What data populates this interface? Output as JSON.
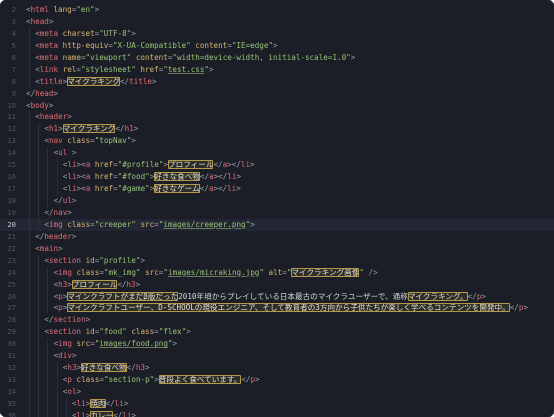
{
  "editor": {
    "theme_colors": {
      "background": "#1b1e26",
      "tag": "#e06c75",
      "attribute": "#d6b476",
      "string": "#98c379",
      "highlight_border": "#b69a4a"
    },
    "active_line": 20,
    "lines": [
      {
        "n": "2",
        "indent": 0,
        "tokens": [
          [
            "p",
            "<"
          ],
          [
            "tag",
            "html"
          ],
          [
            "t",
            " "
          ],
          [
            "attr",
            "lang"
          ],
          [
            "p",
            "="
          ],
          [
            "str",
            "\"en\""
          ],
          [
            "p",
            ">"
          ]
        ]
      },
      {
        "n": "3",
        "indent": 0,
        "tokens": [
          [
            "p",
            "<"
          ],
          [
            "tag",
            "head"
          ],
          [
            "p",
            ">"
          ]
        ]
      },
      {
        "n": "4",
        "indent": 1,
        "tokens": [
          [
            "p",
            "<"
          ],
          [
            "tag",
            "meta"
          ],
          [
            "t",
            " "
          ],
          [
            "attr",
            "charset"
          ],
          [
            "p",
            "="
          ],
          [
            "str",
            "\"UTF-8\""
          ],
          [
            "p",
            ">"
          ]
        ]
      },
      {
        "n": "5",
        "indent": 1,
        "tokens": [
          [
            "p",
            "<"
          ],
          [
            "tag",
            "meta"
          ],
          [
            "t",
            " "
          ],
          [
            "attr",
            "http-equiv"
          ],
          [
            "p",
            "="
          ],
          [
            "str",
            "\"X-UA-Compatible\""
          ],
          [
            "t",
            " "
          ],
          [
            "attr",
            "content"
          ],
          [
            "p",
            "="
          ],
          [
            "str",
            "\"IE=edge\""
          ],
          [
            "p",
            ">"
          ]
        ]
      },
      {
        "n": "6",
        "indent": 1,
        "tokens": [
          [
            "p",
            "<"
          ],
          [
            "tag",
            "meta"
          ],
          [
            "t",
            " "
          ],
          [
            "attr",
            "name"
          ],
          [
            "p",
            "="
          ],
          [
            "str",
            "\"viewport\""
          ],
          [
            "t",
            " "
          ],
          [
            "attr",
            "content"
          ],
          [
            "p",
            "="
          ],
          [
            "str",
            "\"width=device-width, initial-scale=1.0\""
          ],
          [
            "p",
            ">"
          ]
        ]
      },
      {
        "n": "7",
        "indent": 1,
        "tokens": [
          [
            "p",
            "<"
          ],
          [
            "tag",
            "link"
          ],
          [
            "t",
            " "
          ],
          [
            "attr",
            "rel"
          ],
          [
            "p",
            "="
          ],
          [
            "str",
            "\"stylesheet\""
          ],
          [
            "t",
            " "
          ],
          [
            "attr",
            "href"
          ],
          [
            "p",
            "="
          ],
          [
            "str",
            "\""
          ],
          [
            "link",
            "test.css"
          ],
          [
            "str",
            "\""
          ],
          [
            "p",
            ">"
          ]
        ]
      },
      {
        "n": "8",
        "indent": 1,
        "tokens": [
          [
            "p",
            "<"
          ],
          [
            "tag",
            "title"
          ],
          [
            "p",
            ">"
          ],
          [
            "hl",
            "マイクラキング"
          ],
          [
            "p",
            "</"
          ],
          [
            "tag",
            "title"
          ],
          [
            "p",
            ">"
          ]
        ]
      },
      {
        "n": "9",
        "indent": 0,
        "tokens": [
          [
            "p",
            "</"
          ],
          [
            "tag",
            "head"
          ],
          [
            "p",
            ">"
          ]
        ]
      },
      {
        "n": "10",
        "indent": 0,
        "tokens": [
          [
            "p",
            "<"
          ],
          [
            "tag",
            "body"
          ],
          [
            "p",
            ">"
          ]
        ]
      },
      {
        "n": "11",
        "indent": 1,
        "tokens": [
          [
            "p",
            "<"
          ],
          [
            "tag",
            "header"
          ],
          [
            "p",
            ">"
          ]
        ]
      },
      {
        "n": "12",
        "indent": 2,
        "tokens": [
          [
            "p",
            "<"
          ],
          [
            "tag",
            "h1"
          ],
          [
            "p",
            ">"
          ],
          [
            "hl",
            "マイクラキング"
          ],
          [
            "p",
            "</"
          ],
          [
            "tag",
            "h1"
          ],
          [
            "p",
            ">"
          ]
        ]
      },
      {
        "n": "13",
        "indent": 2,
        "tokens": [
          [
            "p",
            "<"
          ],
          [
            "tag",
            "nav"
          ],
          [
            "t",
            " "
          ],
          [
            "attr",
            "class"
          ],
          [
            "p",
            "="
          ],
          [
            "str",
            "\"topNav\""
          ],
          [
            "p",
            ">"
          ]
        ]
      },
      {
        "n": "14",
        "indent": 3,
        "tokens": [
          [
            "p",
            "<"
          ],
          [
            "tag",
            "ul"
          ],
          [
            "t",
            " "
          ],
          [
            "p",
            ">"
          ]
        ]
      },
      {
        "n": "15",
        "indent": 4,
        "tokens": [
          [
            "p",
            "<"
          ],
          [
            "tag",
            "li"
          ],
          [
            "p",
            "><"
          ],
          [
            "tag",
            "a"
          ],
          [
            "t",
            " "
          ],
          [
            "attr",
            "href"
          ],
          [
            "p",
            "="
          ],
          [
            "str",
            "\"#profile\""
          ],
          [
            "p",
            ">"
          ],
          [
            "hl",
            "プロフィール"
          ],
          [
            "p",
            "</"
          ],
          [
            "tag",
            "a"
          ],
          [
            "p",
            "></"
          ],
          [
            "tag",
            "li"
          ],
          [
            "p",
            ">"
          ]
        ]
      },
      {
        "n": "16",
        "indent": 4,
        "tokens": [
          [
            "p",
            "<"
          ],
          [
            "tag",
            "li"
          ],
          [
            "p",
            "><"
          ],
          [
            "tag",
            "a"
          ],
          [
            "t",
            " "
          ],
          [
            "attr",
            "href"
          ],
          [
            "p",
            "="
          ],
          [
            "str",
            "\"#food\""
          ],
          [
            "p",
            ">"
          ],
          [
            "hl",
            "好きな食べ物"
          ],
          [
            "p",
            "</"
          ],
          [
            "tag",
            "a"
          ],
          [
            "p",
            "></"
          ],
          [
            "tag",
            "li"
          ],
          [
            "p",
            ">"
          ]
        ]
      },
      {
        "n": "17",
        "indent": 4,
        "tokens": [
          [
            "p",
            "<"
          ],
          [
            "tag",
            "li"
          ],
          [
            "p",
            "><"
          ],
          [
            "tag",
            "a"
          ],
          [
            "t",
            " "
          ],
          [
            "attr",
            "href"
          ],
          [
            "p",
            "="
          ],
          [
            "str",
            "\"#game\""
          ],
          [
            "p",
            ">"
          ],
          [
            "hl",
            "好きなゲーム"
          ],
          [
            "p",
            "</"
          ],
          [
            "tag",
            "a"
          ],
          [
            "p",
            "></"
          ],
          [
            "tag",
            "li"
          ],
          [
            "p",
            ">"
          ]
        ]
      },
      {
        "n": "18",
        "indent": 3,
        "tokens": [
          [
            "p",
            "</"
          ],
          [
            "tag",
            "ul"
          ],
          [
            "p",
            ">"
          ]
        ]
      },
      {
        "n": "19",
        "indent": 2,
        "tokens": [
          [
            "p",
            "</"
          ],
          [
            "tag",
            "nav"
          ],
          [
            "p",
            ">"
          ]
        ]
      },
      {
        "n": "20",
        "indent": 2,
        "tokens": [
          [
            "p",
            "<"
          ],
          [
            "tag",
            "img"
          ],
          [
            "t",
            " "
          ],
          [
            "attr",
            "class"
          ],
          [
            "p",
            "="
          ],
          [
            "str",
            "\"creeper\""
          ],
          [
            "t",
            " "
          ],
          [
            "attr",
            "src"
          ],
          [
            "p",
            "="
          ],
          [
            "str",
            "\""
          ],
          [
            "link",
            "images/creeper.png"
          ],
          [
            "str",
            "\""
          ],
          [
            "p",
            ">"
          ]
        ]
      },
      {
        "n": "21",
        "indent": 1,
        "tokens": [
          [
            "p",
            "</"
          ],
          [
            "tag",
            "header"
          ],
          [
            "p",
            ">"
          ]
        ]
      },
      {
        "n": "22",
        "indent": 1,
        "tokens": [
          [
            "p",
            "<"
          ],
          [
            "tag",
            "main"
          ],
          [
            "p",
            ">"
          ]
        ]
      },
      {
        "n": "23",
        "indent": 2,
        "tokens": [
          [
            "p",
            "<"
          ],
          [
            "tag",
            "section"
          ],
          [
            "t",
            " "
          ],
          [
            "attr",
            "id"
          ],
          [
            "p",
            "="
          ],
          [
            "str",
            "\"profile\""
          ],
          [
            "p",
            ">"
          ]
        ]
      },
      {
        "n": "24",
        "indent": 3,
        "tokens": [
          [
            "p",
            "<"
          ],
          [
            "tag",
            "img"
          ],
          [
            "t",
            " "
          ],
          [
            "attr",
            "class"
          ],
          [
            "p",
            "="
          ],
          [
            "str",
            "\"mk_img\""
          ],
          [
            "t",
            " "
          ],
          [
            "attr",
            "src"
          ],
          [
            "p",
            "="
          ],
          [
            "str",
            "\""
          ],
          [
            "link",
            "images/micraking.jpg"
          ],
          [
            "str",
            "\""
          ],
          [
            "t",
            " "
          ],
          [
            "attr",
            "alt"
          ],
          [
            "p",
            "="
          ],
          [
            "str",
            "\""
          ],
          [
            "hl",
            "マイクラキング画像"
          ],
          [
            "str",
            "\""
          ],
          [
            "t",
            " "
          ],
          [
            "p",
            "/>"
          ]
        ]
      },
      {
        "n": "25",
        "indent": 3,
        "tokens": [
          [
            "p",
            "<"
          ],
          [
            "tag",
            "h3"
          ],
          [
            "p",
            ">"
          ],
          [
            "hl",
            "プロフィール"
          ],
          [
            "p",
            "</"
          ],
          [
            "tag",
            "h3"
          ],
          [
            "p",
            ">"
          ]
        ]
      },
      {
        "n": "26",
        "indent": 3,
        "tokens": [
          [
            "p",
            "<"
          ],
          [
            "tag",
            "p"
          ],
          [
            "p",
            ">"
          ],
          [
            "hl",
            "マインクラフトがまだβ版だった"
          ],
          [
            "t",
            "2010年頃からプレイしている日本最古のマイクラユーザーで、通称"
          ],
          [
            "hl",
            "マイクラキング。"
          ],
          [
            "p",
            "</"
          ],
          [
            "tag",
            "p"
          ],
          [
            "p",
            ">"
          ]
        ]
      },
      {
        "n": "27",
        "indent": 3,
        "tokens": [
          [
            "p",
            "<"
          ],
          [
            "tag",
            "p"
          ],
          [
            "p",
            ">"
          ],
          [
            "hl",
            "マインクラフトユーザー、D-SCHOOLの現役エンジニア、そして教育者の3方向から子供たちが楽しく学べるコンテンツを開発中。"
          ],
          [
            "p",
            "</"
          ],
          [
            "tag",
            "p"
          ],
          [
            "p",
            ">"
          ]
        ]
      },
      {
        "n": "28",
        "indent": 2,
        "tokens": [
          [
            "p",
            "</"
          ],
          [
            "tag",
            "section"
          ],
          [
            "p",
            ">"
          ]
        ]
      },
      {
        "n": "29",
        "indent": 2,
        "tokens": [
          [
            "p",
            "<"
          ],
          [
            "tag",
            "section"
          ],
          [
            "t",
            " "
          ],
          [
            "attr",
            "id"
          ],
          [
            "p",
            "="
          ],
          [
            "str",
            "\"food\""
          ],
          [
            "t",
            " "
          ],
          [
            "attr",
            "class"
          ],
          [
            "p",
            "="
          ],
          [
            "str",
            "\"flex\""
          ],
          [
            "p",
            ">"
          ]
        ]
      },
      {
        "n": "30",
        "indent": 3,
        "tokens": [
          [
            "p",
            "<"
          ],
          [
            "tag",
            "img"
          ],
          [
            "t",
            " "
          ],
          [
            "attr",
            "src"
          ],
          [
            "p",
            "="
          ],
          [
            "str",
            "\""
          ],
          [
            "link",
            "images/food.png"
          ],
          [
            "str",
            "\""
          ],
          [
            "p",
            ">"
          ]
        ]
      },
      {
        "n": "31",
        "indent": 3,
        "tokens": [
          [
            "p",
            "<"
          ],
          [
            "tag",
            "div"
          ],
          [
            "p",
            ">"
          ]
        ]
      },
      {
        "n": "32",
        "indent": 4,
        "tokens": [
          [
            "p",
            "<"
          ],
          [
            "tag",
            "h3"
          ],
          [
            "p",
            ">"
          ],
          [
            "hl",
            "好きな食べ物"
          ],
          [
            "p",
            "</"
          ],
          [
            "tag",
            "h3"
          ],
          [
            "p",
            ">"
          ]
        ]
      },
      {
        "n": "33",
        "indent": 4,
        "tokens": [
          [
            "p",
            "<"
          ],
          [
            "tag",
            "p"
          ],
          [
            "t",
            " "
          ],
          [
            "attr",
            "class"
          ],
          [
            "p",
            "="
          ],
          [
            "str",
            "\"section-p\""
          ],
          [
            "p",
            ">"
          ],
          [
            "hl",
            "普段よく食べています。"
          ],
          [
            "p",
            "</"
          ],
          [
            "tag",
            "p"
          ],
          [
            "p",
            ">"
          ]
        ]
      },
      {
        "n": "34",
        "indent": 4,
        "tokens": [
          [
            "p",
            "<"
          ],
          [
            "tag",
            "ol"
          ],
          [
            "p",
            ">"
          ]
        ]
      },
      {
        "n": "35",
        "indent": 5,
        "tokens": [
          [
            "p",
            "<"
          ],
          [
            "tag",
            "li"
          ],
          [
            "p",
            ">"
          ],
          [
            "hl",
            "焼肉"
          ],
          [
            "p",
            "</"
          ],
          [
            "tag",
            "li"
          ],
          [
            "p",
            ">"
          ]
        ]
      },
      {
        "n": "36",
        "indent": 5,
        "tokens": [
          [
            "p",
            "<"
          ],
          [
            "tag",
            "li"
          ],
          [
            "p",
            ">"
          ],
          [
            "hl",
            "カレー"
          ],
          [
            "p",
            "</"
          ],
          [
            "tag",
            "li"
          ],
          [
            "p",
            ">"
          ]
        ]
      }
    ]
  }
}
